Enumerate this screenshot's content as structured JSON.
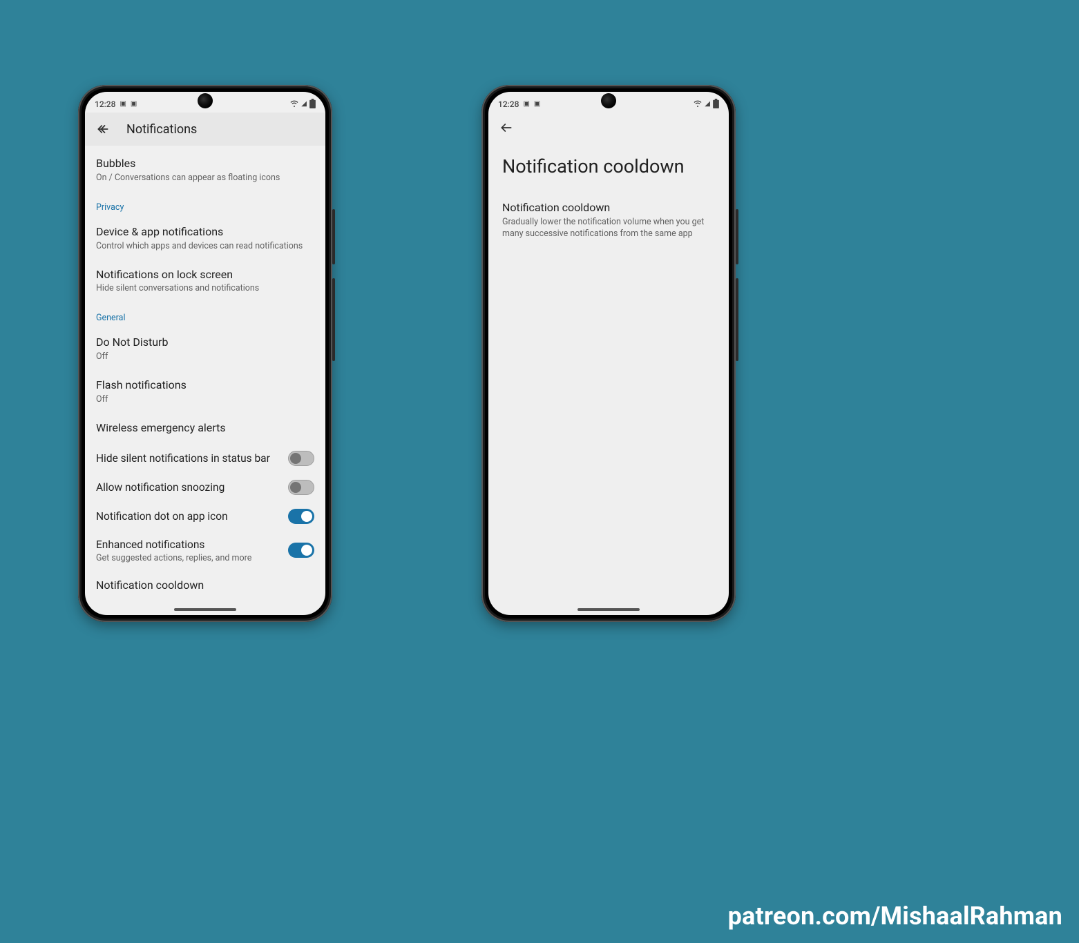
{
  "statusbar": {
    "time": "12:28"
  },
  "phone1": {
    "title": "Notifications",
    "items": {
      "bubbles": {
        "title": "Bubbles",
        "sub": "On / Conversations can appear as floating icons"
      },
      "privacy_header": "Privacy",
      "device_app": {
        "title": "Device & app notifications",
        "sub": "Control which apps and devices can read notifications"
      },
      "lockscreen": {
        "title": "Notifications on lock screen",
        "sub": "Hide silent conversations and notifications"
      },
      "general_header": "General",
      "dnd": {
        "title": "Do Not Disturb",
        "sub": "Off"
      },
      "flash": {
        "title": "Flash notifications",
        "sub": "Off"
      },
      "wea": {
        "title": "Wireless emergency alerts"
      },
      "hide_silent": {
        "title": "Hide silent notifications in status bar"
      },
      "snoozing": {
        "title": "Allow notification snoozing"
      },
      "dot": {
        "title": "Notification dot on app icon"
      },
      "enhanced": {
        "title": "Enhanced notifications",
        "sub": "Get suggested actions, replies, and more"
      },
      "cooldown": {
        "title": "Notification cooldown"
      }
    }
  },
  "phone2": {
    "big_title": "Notification cooldown",
    "detail_title": "Notification cooldown",
    "detail_sub": "Gradually lower the notification volume when you get many successive notifications from the same app"
  },
  "watermark": "patreon.com/MishaalRahman"
}
